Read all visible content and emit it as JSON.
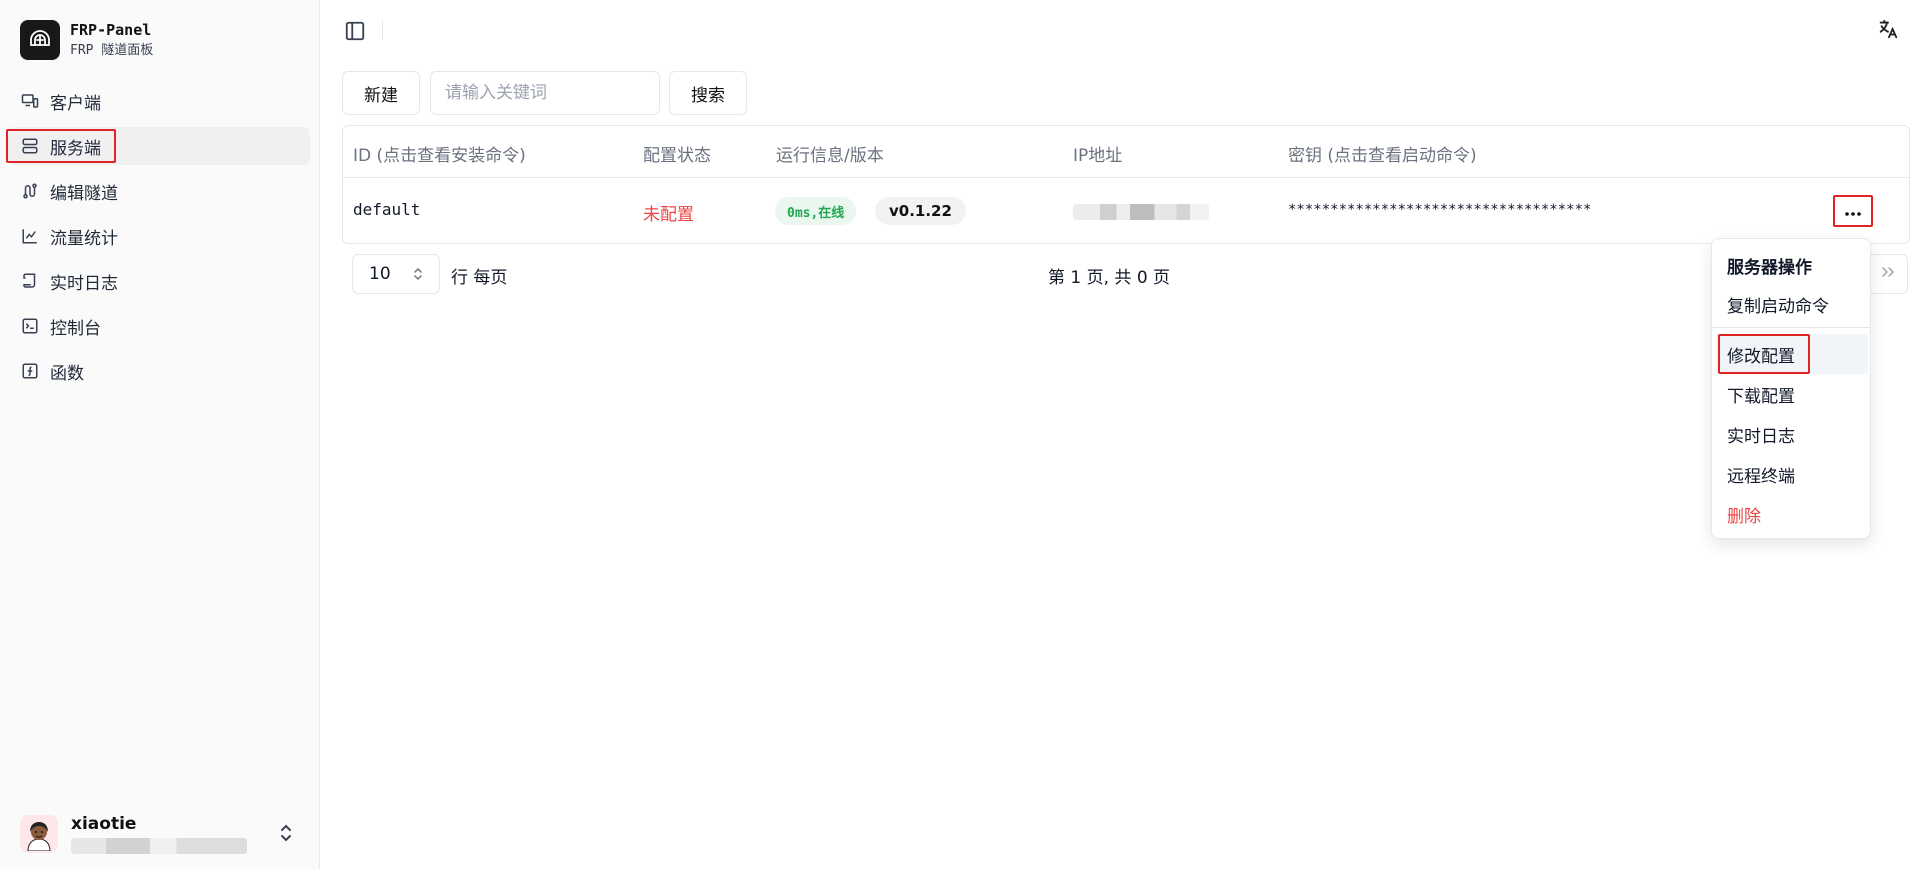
{
  "brand": {
    "title": "FRP-Panel",
    "subtitle": "FRP 隧道面板"
  },
  "sidebar": {
    "items": [
      {
        "label": "客户端",
        "icon": "client-monitor-icon"
      },
      {
        "label": "服务端",
        "icon": "server-icon",
        "active": true
      },
      {
        "label": "编辑隧道",
        "icon": "route-icon"
      },
      {
        "label": "流量统计",
        "icon": "chart-icon"
      },
      {
        "label": "实时日志",
        "icon": "scroll-icon"
      },
      {
        "label": "控制台",
        "icon": "terminal-icon"
      },
      {
        "label": "函数",
        "icon": "function-icon"
      }
    ]
  },
  "user": {
    "name": "xiaotie"
  },
  "toolbar": {
    "new_label": "新建",
    "search_placeholder": "请输入关键词",
    "search_label": "搜索"
  },
  "table": {
    "headers": [
      "ID (点击查看安装命令)",
      "配置状态",
      "运行信息/版本",
      "IP地址",
      "密钥 (点击查看启动命令)"
    ],
    "rows": [
      {
        "id": "default",
        "config_status": "未配置",
        "runtime_status": "0ms,在线",
        "version": "v0.1.22",
        "secret": "************************************"
      }
    ]
  },
  "pagination": {
    "page_size": "10",
    "rows_label": "行 每页",
    "info": "第 1 页, 共 0 页"
  },
  "menu": {
    "title": "服务器操作",
    "items": [
      "复制启动命令",
      "修改配置",
      "下载配置",
      "实时日志",
      "远程终端",
      "删除"
    ]
  },
  "colors": {
    "danger": "#ef4444",
    "online": "#22a652",
    "highlight": "#e02424"
  }
}
